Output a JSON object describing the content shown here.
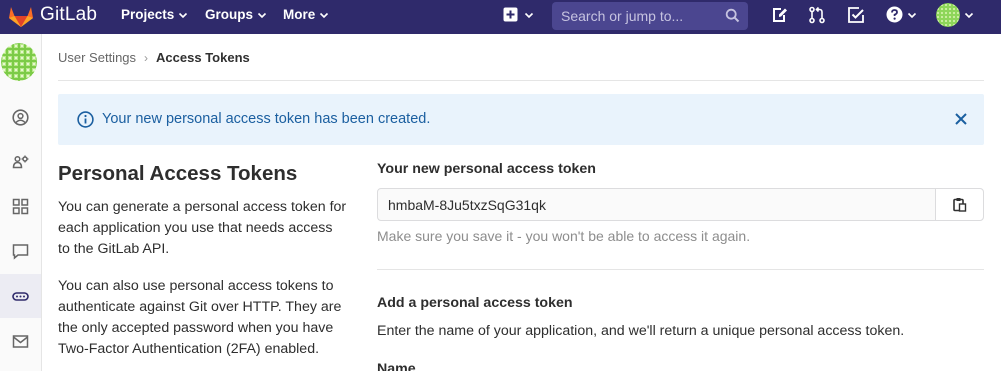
{
  "navbar": {
    "brand": "GitLab",
    "links": [
      "Projects",
      "Groups",
      "More"
    ],
    "search_placeholder": "Search or jump to..."
  },
  "breadcrumb": {
    "parent": "User Settings",
    "separator": "›",
    "current": "Access Tokens"
  },
  "alert": {
    "message": "Your new personal access token has been created."
  },
  "left": {
    "title": "Personal Access Tokens",
    "paragraph1": "You can generate a personal access token for each application you use that needs access to the GitLab API.",
    "paragraph2": "You can also use personal access tokens to authenticate against Git over HTTP. They are the only accepted password when you have Two-Factor Authentication (2FA) enabled."
  },
  "right": {
    "new_token_label": "Your new personal access token",
    "token_value": "hmbaM-8Ju5txzSqG31qk",
    "token_help": "Make sure you save it - you won't be able to access it again.",
    "add_title": "Add a personal access token",
    "add_description": "Enter the name of your application, and we'll return a unique personal access token.",
    "name_label": "Name"
  },
  "colors": {
    "navbar": "#2f2a6b",
    "alert_bg": "#e9f3fc",
    "alert_text": "#1b5fa0"
  },
  "icons": {
    "sidebar": [
      "profile-icon",
      "account-icon",
      "applications-icon",
      "chat-icon",
      "token-icon",
      "mail-icon"
    ]
  }
}
